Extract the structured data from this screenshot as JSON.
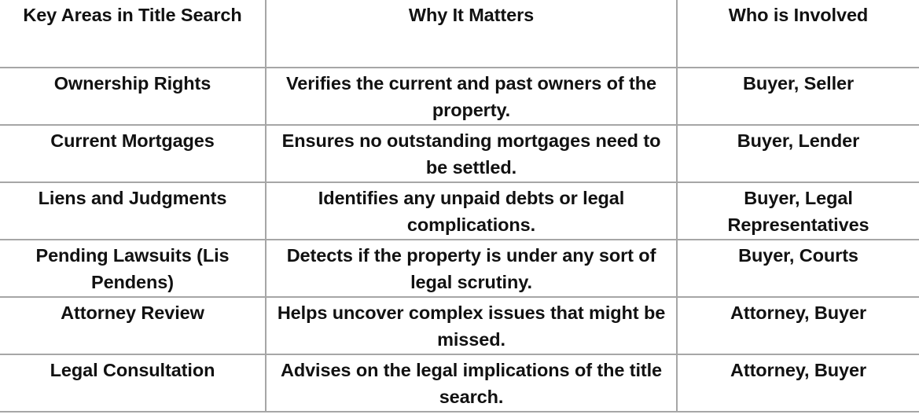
{
  "table": {
    "caption": "Key Areas in Title Search",
    "columns": [
      {
        "id": "key_areas",
        "label": "Key Areas in Title Search"
      },
      {
        "id": "why_it_matters",
        "label": "Why It Matters"
      },
      {
        "id": "who_is_involved",
        "label": "Who is Involved"
      }
    ],
    "rows": [
      {
        "key_areas": "Ownership Rights",
        "why_it_matters": "Verifies the current and past owners of the property.",
        "who_is_involved": "Buyer, Seller"
      },
      {
        "key_areas": "Current Mortgages",
        "why_it_matters": "Ensures no outstanding mortgages need to be settled.",
        "who_is_involved": "Buyer, Lender"
      },
      {
        "key_areas": "Liens and Judgments",
        "why_it_matters": "Identifies any unpaid debts or legal complications.",
        "who_is_involved": "Buyer, Legal Representatives"
      },
      {
        "key_areas": "Pending Lawsuits (Lis Pendens)",
        "why_it_matters": "Detects if the property is under any sort of legal scrutiny.",
        "who_is_involved": "Buyer, Courts"
      },
      {
        "key_areas": "Attorney Review",
        "why_it_matters": "Helps uncover complex issues that might be missed.",
        "who_is_involved": "Attorney, Buyer"
      },
      {
        "key_areas": "Legal Consultation",
        "why_it_matters": "Advises on the legal implications of the title search.",
        "who_is_involved": "Attorney, Buyer"
      }
    ],
    "style": {
      "border_color": "#a6a6a6",
      "text_color": "#111111",
      "background_color": "#ffffff"
    }
  }
}
